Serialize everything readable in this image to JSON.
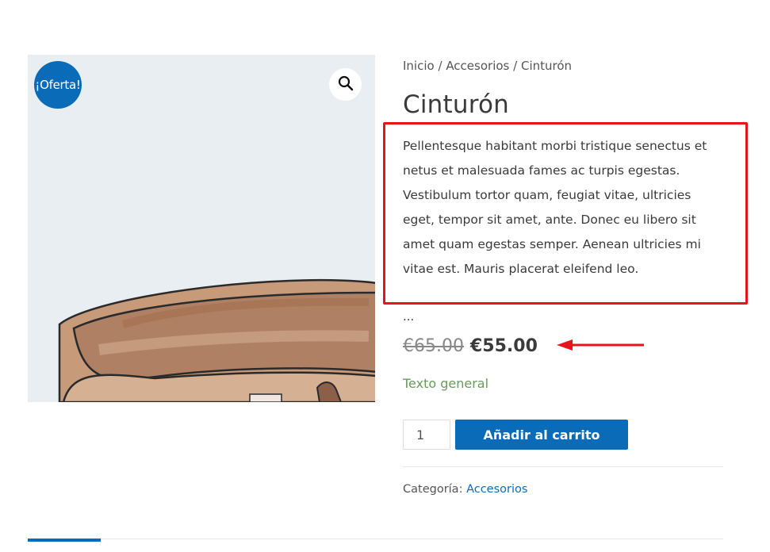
{
  "product": {
    "sale_badge": "¡Oferta!",
    "title": "Cinturón",
    "short_description": "Pellentesque habitant morbi tristique senectus et netus et malesuada fames ac turpis egestas. Vestibulum tortor quam, feugiat vitae, ultricies eget, tempor sit amet, ante. Donec eu libero sit amet quam egestas semper. Aenean ultricies mi vitae est. Mauris placerat eleifend leo.",
    "ellipsis": "...",
    "old_price": "€65.00",
    "new_price": "€55.00",
    "stock_text": "Texto general",
    "quantity": "1",
    "add_to_cart_label": "Añadir al carrito",
    "category_label": "Categoría: ",
    "category_value": "Accesorios"
  },
  "breadcrumb": {
    "items": [
      "Inicio",
      "Accesorios",
      "Cinturón"
    ],
    "separator": "/"
  },
  "icons": {
    "zoom": "magnifier-icon",
    "annotation_arrow": "red-arrow-icon"
  },
  "colors": {
    "accent": "#0a6bb8",
    "annotation": "#e6141b",
    "stock": "#6a9a5b",
    "image_background": "#e9eef3"
  }
}
